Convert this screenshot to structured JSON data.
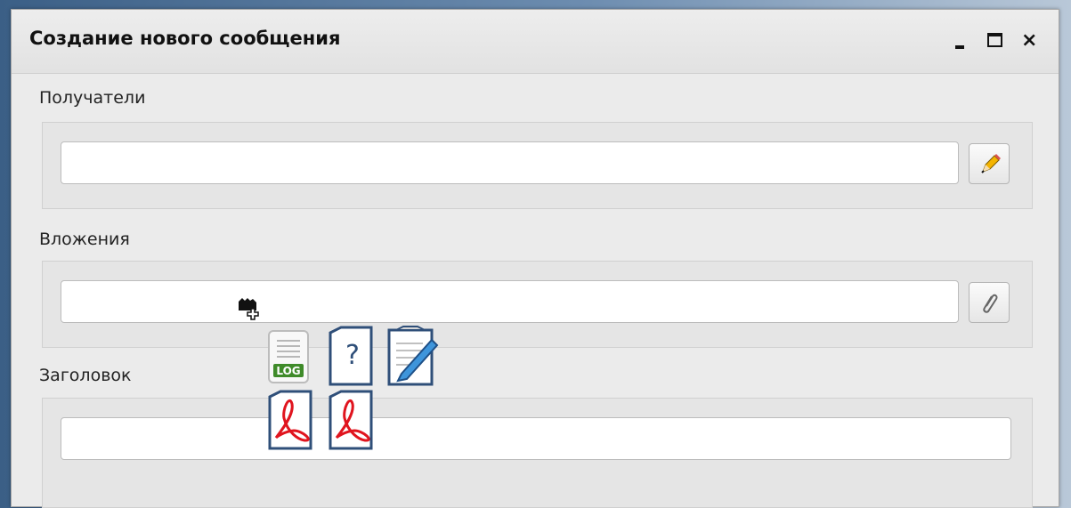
{
  "window": {
    "title": "Создание нового сообщения",
    "controls": [
      "minimize",
      "maximize",
      "close"
    ],
    "close_label": "×"
  },
  "fields": {
    "recipients": {
      "label": "Получатели",
      "value": "",
      "button_icon": "pencil-icon"
    },
    "attachments": {
      "label": "Вложения",
      "value": "",
      "button_icon": "paperclip-icon"
    },
    "subject": {
      "label": "Заголовок",
      "value": ""
    }
  },
  "drag_files": [
    {
      "type": "log",
      "icon": "log-file-icon",
      "badge": "LOG"
    },
    {
      "type": "unknown",
      "icon": "unknown-file-icon",
      "badge": "?"
    },
    {
      "type": "text",
      "icon": "text-file-icon"
    },
    {
      "type": "pdf",
      "icon": "pdf-file-icon"
    },
    {
      "type": "pdf",
      "icon": "pdf-file-icon"
    }
  ],
  "colors": {
    "pdf_red": "#e0141e",
    "file_border": "#2f4f79",
    "log_green": "#3f8b2a"
  }
}
